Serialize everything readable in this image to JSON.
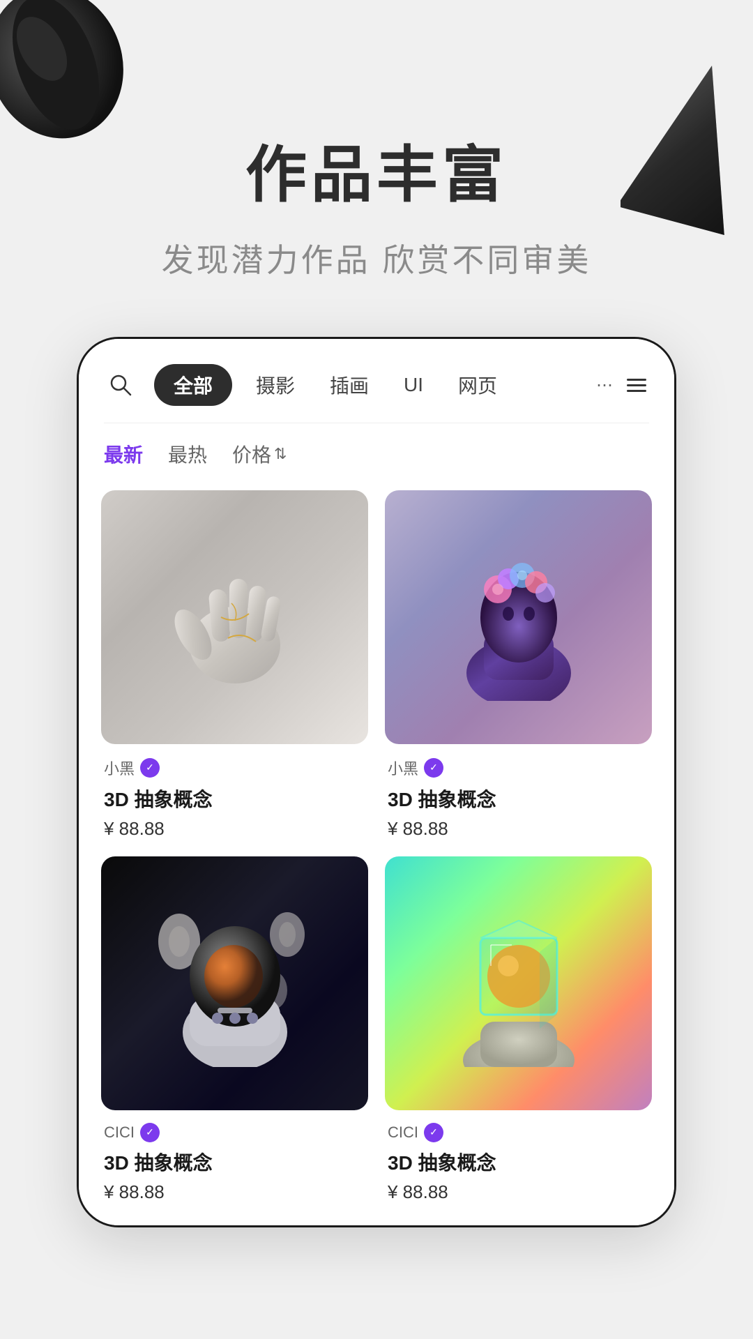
{
  "hero": {
    "title": "作品丰富",
    "subtitle": "发现潜力作品 欣赏不同审美"
  },
  "app": {
    "nav": {
      "search_placeholder": "搜索",
      "pills": [
        {
          "label": "全部",
          "active": true
        },
        {
          "label": "摄影",
          "active": false
        },
        {
          "label": "插画",
          "active": false
        },
        {
          "label": "UI",
          "active": false
        },
        {
          "label": "网页",
          "active": false
        }
      ],
      "more_label": "≡"
    },
    "sort_tabs": [
      {
        "label": "最新",
        "active": true
      },
      {
        "label": "最热",
        "active": false
      },
      {
        "label": "价格",
        "active": false
      }
    ],
    "products": [
      {
        "id": "p1",
        "author": "小黑",
        "verified": true,
        "title": "3D 抽象概念",
        "price": "¥ 88.88",
        "image_type": "hand"
      },
      {
        "id": "p2",
        "author": "小黑",
        "verified": true,
        "title": "3D 抽象概念",
        "price": "¥ 88.88",
        "image_type": "bust"
      },
      {
        "id": "p3",
        "author": "CICI",
        "verified": true,
        "title": "3D 抽象概念",
        "price": "¥ 88.88",
        "image_type": "astronaut"
      },
      {
        "id": "p4",
        "author": "CICI",
        "verified": true,
        "title": "3D 抽象概念",
        "price": "¥ 88.88",
        "image_type": "cube"
      }
    ],
    "verified_icon": "✓",
    "price_sort_arrow": "⇕",
    "more_nav_icon": "⋯"
  }
}
